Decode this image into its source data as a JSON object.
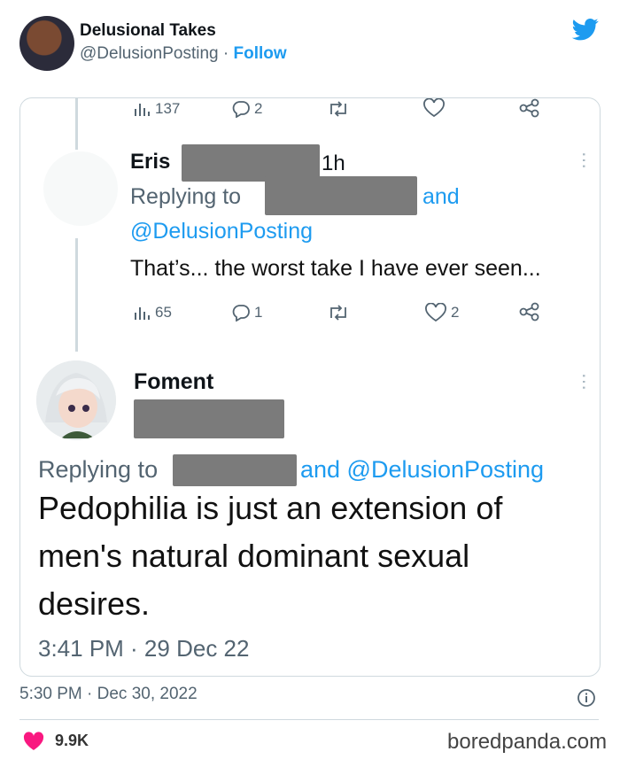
{
  "tweet": {
    "author_name": "Delusional Takes",
    "author_handle": "@DelusionPosting",
    "separator": " · ",
    "follow_label": "Follow",
    "timestamp": "5:30 PM · Dec 30, 2022",
    "likes": "9.9K"
  },
  "screenshot": {
    "top_stats": {
      "views": "137",
      "replies": "2"
    },
    "reply1": {
      "name": "Eris",
      "time": "1h",
      "replying_to": "Replying to",
      "and": "and",
      "mention": "@DelusionPosting",
      "text": "That’s... the worst take I have ever seen...",
      "views": "65",
      "replies": "1",
      "likes": "2"
    },
    "reply2": {
      "name": "Foment",
      "replying_to": "Replying to",
      "and_mention": "and @DelusionPosting",
      "text_lines": [
        "Pedophilia is just an extension of",
        "men's natural dominant sexual",
        "desires."
      ],
      "time": "3:41 PM · 29 Dec 22"
    }
  },
  "watermark": "boredpanda.com",
  "colors": {
    "link": "#1d9bf0",
    "heart": "#f91880",
    "muted": "#536471"
  },
  "icons": [
    "twitter-bird-icon",
    "views-icon",
    "reply-icon",
    "retweet-icon",
    "like-icon",
    "share-icon",
    "more-icon",
    "info-icon",
    "heart-icon"
  ]
}
